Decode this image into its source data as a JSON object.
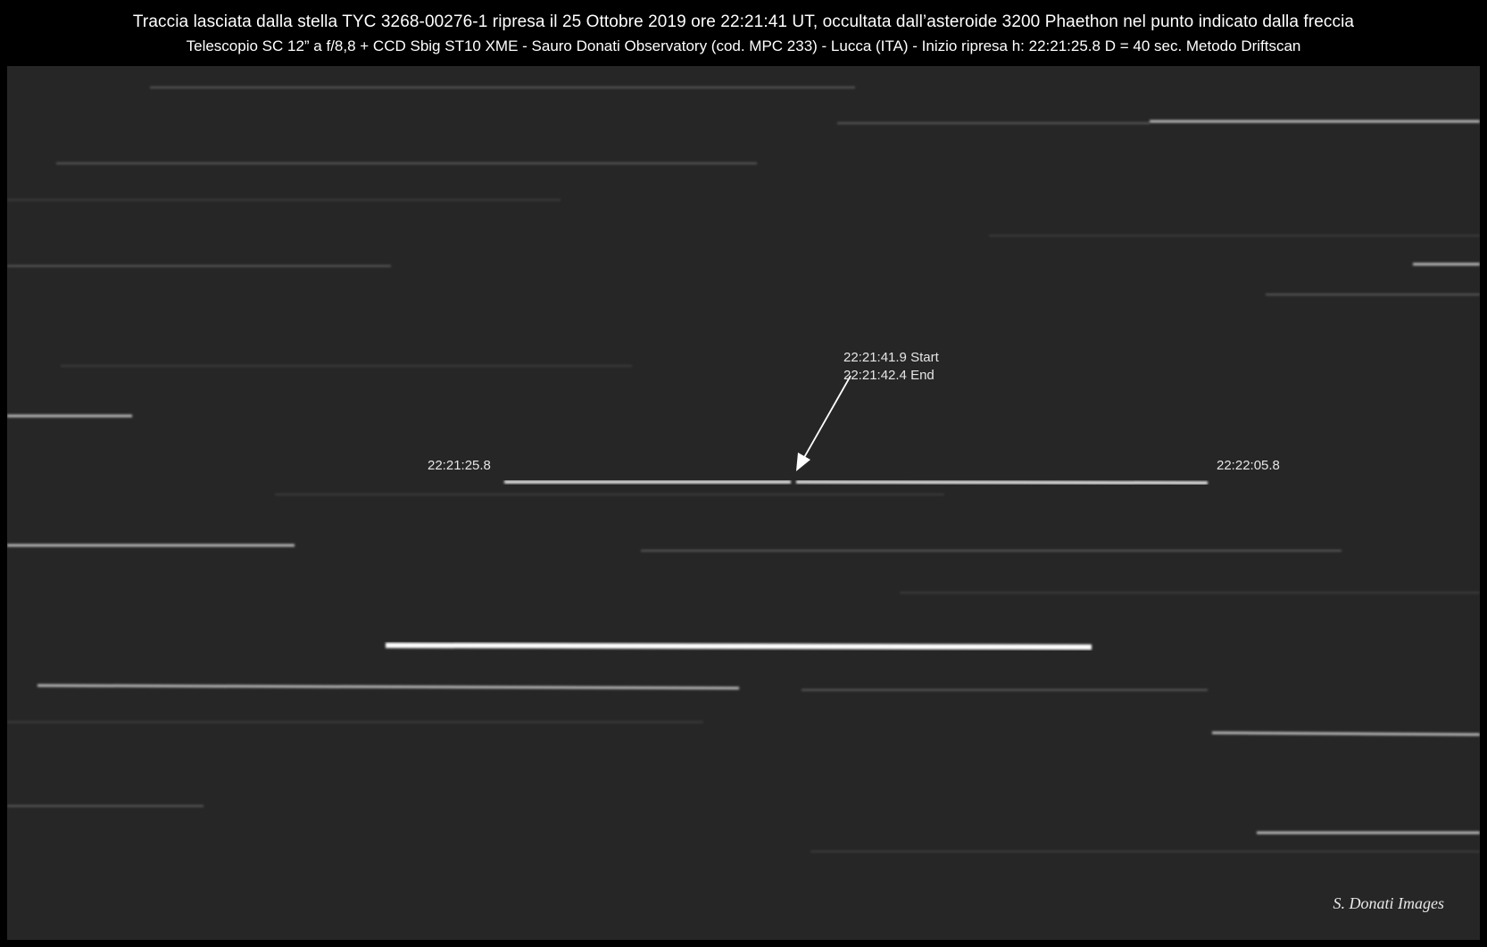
{
  "header": {
    "title_line": "Traccia lasciata dalla stella TYC 3268-00276-1 ripresa il 25 Ottobre 2019 ore 22:21:41 UT,  occultata dall’asteroide 3200 Phaethon nel punto indicato dalla freccia",
    "subtitle_line": "Telescopio SC 12” a f/8,8 + CCD Sbig ST10 XME - Sauro Donati Observatory (cod. MPC 233) - Lucca (ITA) - Inizio ripresa h: 22:21:25.8  D = 40 sec. Metodo Driftscan"
  },
  "annotations": {
    "start_label": "22:21:41.9  Start",
    "end_label": "22:21:42.4  End",
    "trail_start_time": "22:21:25.8",
    "trail_end_time": "22:22:05.8"
  },
  "credit": "S. Donati Images",
  "colors": {
    "background": "#262626",
    "frame": "#000000",
    "text": "#ffffff"
  }
}
